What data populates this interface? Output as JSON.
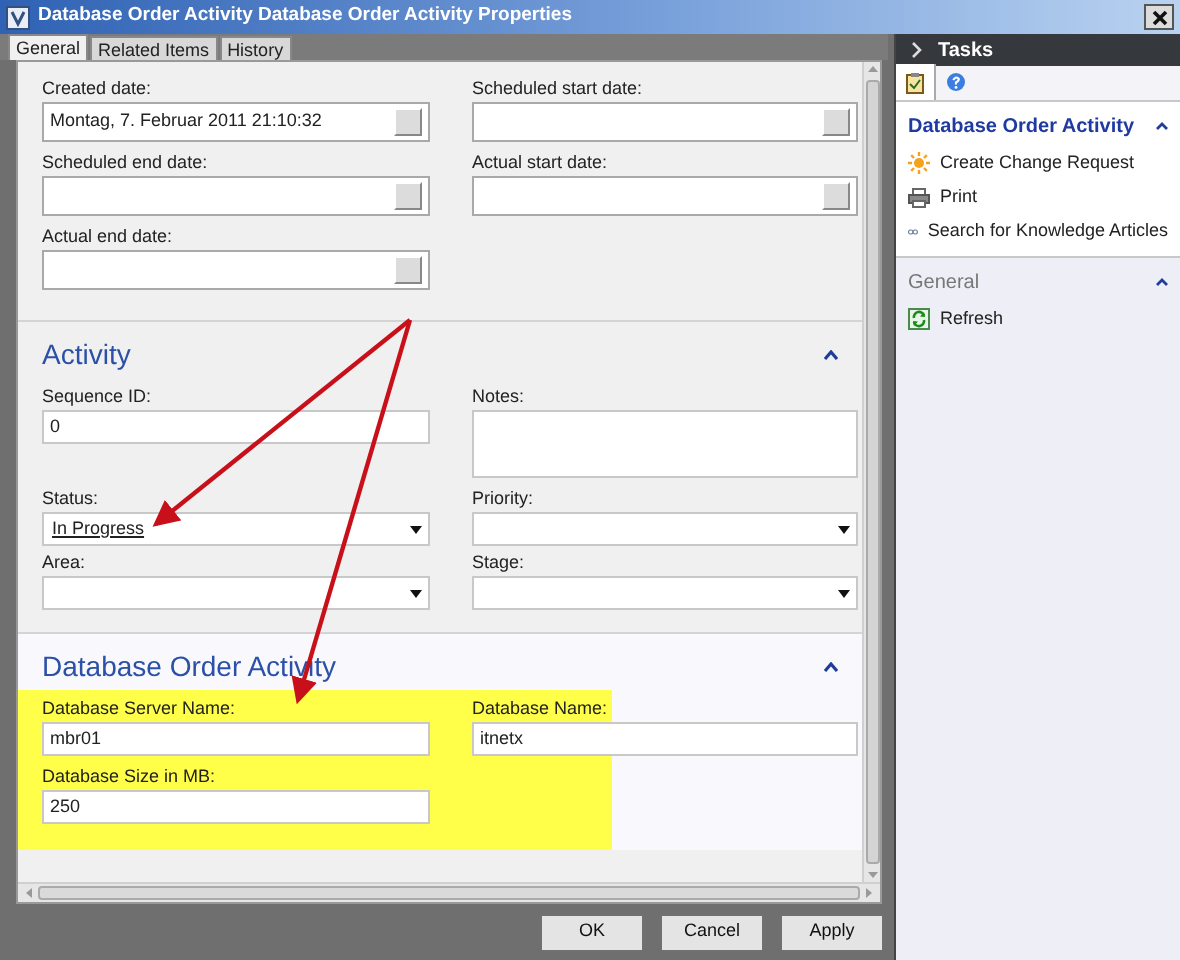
{
  "window": {
    "title": "Database Order Activity Database Order Activity Properties"
  },
  "tabs": [
    {
      "label": "General",
      "selected": true
    },
    {
      "label": "Related Items",
      "selected": false
    },
    {
      "label": "History",
      "selected": false
    }
  ],
  "sections": [
    {
      "fields": [
        {
          "kind": "date",
          "label": "Created date:",
          "value": "Montag, 7. Februar 2011 21:10:32"
        },
        {
          "kind": "date",
          "label": "Scheduled start date:"
        },
        {
          "kind": "date",
          "label": "Scheduled end date:"
        },
        {
          "kind": "date",
          "label": "Actual start date:"
        },
        {
          "kind": "date",
          "label": "Actual end date:"
        }
      ]
    },
    {
      "title": "Activity",
      "expanded": true,
      "fields": [
        {
          "kind": "text",
          "label": "Sequence ID:",
          "value": "0"
        },
        {
          "kind": "textarea",
          "label": "Notes:"
        },
        {
          "kind": "dropdown",
          "label": "Status:",
          "value": "In Progress"
        },
        {
          "kind": "dropdown",
          "label": "Priority:"
        },
        {
          "kind": "dropdown",
          "label": "Area:"
        },
        {
          "kind": "dropdown",
          "label": "Stage:"
        }
      ]
    },
    {
      "title": "Database Order Activity",
      "expanded": true,
      "highlighted": true,
      "fields": [
        {
          "kind": "text",
          "label": "Database Server Name:",
          "value": "mbr01"
        },
        {
          "kind": "text",
          "label": "Database Name:",
          "value": "itnetx"
        },
        {
          "kind": "text",
          "label": "Database Size in MB:",
          "value": "250"
        }
      ]
    }
  ],
  "buttons": [
    "OK",
    "Cancel",
    "Apply"
  ],
  "tasks": {
    "title": "Tasks",
    "tabs": [
      {
        "kind": "tasks",
        "selected": true
      },
      {
        "kind": "help",
        "selected": false
      }
    ],
    "groups": [
      {
        "title": "Database Order Activity",
        "active": true,
        "expanded": true,
        "items": [
          {
            "kind": "sun",
            "label": "Create Change Request"
          },
          {
            "kind": "printer",
            "label": "Print"
          },
          {
            "kind": "link",
            "label": "Search for Knowledge Articles"
          }
        ]
      },
      {
        "title": "General",
        "active": false,
        "expanded": true,
        "items": [
          {
            "kind": "refresh",
            "label": "Refresh"
          }
        ]
      }
    ]
  }
}
